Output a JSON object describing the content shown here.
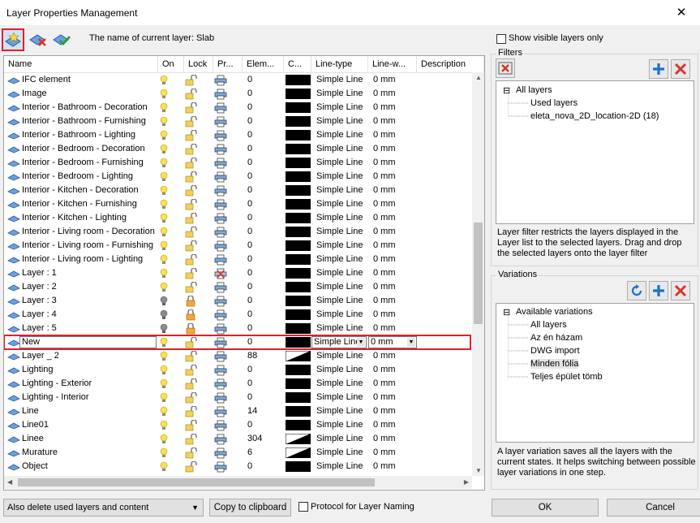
{
  "window": {
    "title": "Layer Properties Management",
    "close_glyph": "✕"
  },
  "toolbar": {
    "new_layer_icon": "new-layer-icon",
    "delete_layer_icon": "delete-layer-icon",
    "set_current_icon": "set-current-layer-icon",
    "current_layer_label": "The name of current layer: Slab"
  },
  "table": {
    "columns": [
      {
        "key": "name",
        "label": "Name"
      },
      {
        "key": "on",
        "label": "On"
      },
      {
        "key": "lock",
        "label": "Lock"
      },
      {
        "key": "print",
        "label": "Pr..."
      },
      {
        "key": "elem",
        "label": "Elem..."
      },
      {
        "key": "color",
        "label": "C..."
      },
      {
        "key": "linetype",
        "label": "Line-type"
      },
      {
        "key": "linewidth",
        "label": "Line-w..."
      },
      {
        "key": "description",
        "label": "Description"
      }
    ],
    "rows": [
      {
        "name": "IFC element",
        "on": true,
        "locked": false,
        "print": true,
        "elem": "0",
        "color": "solid",
        "linetype": "Simple Line",
        "lw": "0 mm"
      },
      {
        "name": "Image",
        "on": true,
        "locked": false,
        "print": true,
        "elem": "0",
        "color": "solid",
        "linetype": "Simple Line",
        "lw": "0 mm"
      },
      {
        "name": "Interior - Bathroom - Decoration",
        "on": true,
        "locked": false,
        "print": true,
        "elem": "0",
        "color": "solid",
        "linetype": "Simple Line",
        "lw": "0 mm"
      },
      {
        "name": "Interior - Bathroom - Furnishing",
        "on": true,
        "locked": false,
        "print": true,
        "elem": "0",
        "color": "solid",
        "linetype": "Simple Line",
        "lw": "0 mm"
      },
      {
        "name": "Interior - Bathroom - Lighting",
        "on": true,
        "locked": false,
        "print": true,
        "elem": "0",
        "color": "solid",
        "linetype": "Simple Line",
        "lw": "0 mm"
      },
      {
        "name": "Interior - Bedroom - Decoration",
        "on": true,
        "locked": false,
        "print": true,
        "elem": "0",
        "color": "solid",
        "linetype": "Simple Line",
        "lw": "0 mm"
      },
      {
        "name": "Interior - Bedroom - Furnishing",
        "on": true,
        "locked": false,
        "print": true,
        "elem": "0",
        "color": "solid",
        "linetype": "Simple Line",
        "lw": "0 mm"
      },
      {
        "name": "Interior - Bedroom - Lighting",
        "on": true,
        "locked": false,
        "print": true,
        "elem": "0",
        "color": "solid",
        "linetype": "Simple Line",
        "lw": "0 mm"
      },
      {
        "name": "Interior - Kitchen - Decoration",
        "on": true,
        "locked": false,
        "print": true,
        "elem": "0",
        "color": "solid",
        "linetype": "Simple Line",
        "lw": "0 mm"
      },
      {
        "name": "Interior - Kitchen - Furnishing",
        "on": true,
        "locked": false,
        "print": true,
        "elem": "0",
        "color": "solid",
        "linetype": "Simple Line",
        "lw": "0 mm"
      },
      {
        "name": "Interior - Kitchen - Lighting",
        "on": true,
        "locked": false,
        "print": true,
        "elem": "0",
        "color": "solid",
        "linetype": "Simple Line",
        "lw": "0 mm"
      },
      {
        "name": "Interior - Living room - Decoration",
        "on": true,
        "locked": false,
        "print": true,
        "elem": "0",
        "color": "solid",
        "linetype": "Simple Line",
        "lw": "0 mm"
      },
      {
        "name": "Interior - Living room - Furnishing",
        "on": true,
        "locked": false,
        "print": true,
        "elem": "0",
        "color": "solid",
        "linetype": "Simple Line",
        "lw": "0 mm"
      },
      {
        "name": "Interior - Living room - Lighting",
        "on": true,
        "locked": false,
        "print": true,
        "elem": "0",
        "color": "solid",
        "linetype": "Simple Line",
        "lw": "0 mm"
      },
      {
        "name": "Layer :  1",
        "on": true,
        "locked": false,
        "print": false,
        "elem": "0",
        "color": "solid",
        "linetype": "Simple Line",
        "lw": "0 mm"
      },
      {
        "name": "Layer :  2",
        "on": true,
        "locked": false,
        "print": true,
        "elem": "0",
        "color": "solid",
        "linetype": "Simple Line",
        "lw": "0 mm"
      },
      {
        "name": "Layer :  3",
        "on": false,
        "locked": true,
        "print": true,
        "elem": "0",
        "color": "solid",
        "linetype": "Simple Line",
        "lw": "0 mm"
      },
      {
        "name": "Layer :  4",
        "on": false,
        "locked": true,
        "print": true,
        "elem": "0",
        "color": "solid",
        "linetype": "Simple Line",
        "lw": "0 mm"
      },
      {
        "name": "Layer :  5",
        "on": false,
        "locked": true,
        "print": true,
        "elem": "0",
        "color": "solid",
        "linetype": "Simple Line",
        "lw": "0 mm"
      },
      {
        "name": "New",
        "on": true,
        "locked": false,
        "print": true,
        "elem": "0",
        "color": "solid",
        "linetype": "Simple Line",
        "lw": "0 mm",
        "editing": true
      },
      {
        "name": "Layer _ 2",
        "on": true,
        "locked": false,
        "print": true,
        "elem": "88",
        "color": "diag",
        "linetype": "Simple Line",
        "lw": "0 mm"
      },
      {
        "name": "Lighting",
        "on": true,
        "locked": false,
        "print": true,
        "elem": "0",
        "color": "solid",
        "linetype": "Simple Line",
        "lw": "0 mm"
      },
      {
        "name": "Lighting - Exterior",
        "on": true,
        "locked": false,
        "print": true,
        "elem": "0",
        "color": "solid",
        "linetype": "Simple Line",
        "lw": "0 mm"
      },
      {
        "name": "Lighting - Interior",
        "on": true,
        "locked": false,
        "print": true,
        "elem": "0",
        "color": "solid",
        "linetype": "Simple Line",
        "lw": "0 mm"
      },
      {
        "name": "Line",
        "on": true,
        "locked": false,
        "print": true,
        "elem": "14",
        "color": "solid",
        "linetype": "Simple Line",
        "lw": "0 mm"
      },
      {
        "name": "Line01",
        "on": true,
        "locked": false,
        "print": true,
        "elem": "0",
        "color": "solid",
        "linetype": "Simple Line",
        "lw": "0 mm"
      },
      {
        "name": "Linee",
        "on": true,
        "locked": false,
        "print": true,
        "elem": "304",
        "color": "diag",
        "linetype": "Simple Line",
        "lw": "0 mm"
      },
      {
        "name": "Murature",
        "on": true,
        "locked": false,
        "print": true,
        "elem": "6",
        "color": "diag",
        "linetype": "Simple Line",
        "lw": "0 mm"
      },
      {
        "name": "Object",
        "on": true,
        "locked": false,
        "print": true,
        "elem": "0",
        "color": "solid",
        "linetype": "Simple Line",
        "lw": "0 mm"
      }
    ]
  },
  "right": {
    "show_visible_label": "Show visible layers only",
    "filters_label": "Filters",
    "filters_tree": [
      {
        "label": "All layers",
        "level": 0,
        "expander": "⊟"
      },
      {
        "label": "Used layers",
        "level": 1
      },
      {
        "label": "eleta_nova_2D_location-2D (18)",
        "level": 1
      }
    ],
    "filters_desc": "Layer filter restricts the layers displayed in the Layer list to the selected layers. Drag and drop the selected layers onto the layer filter",
    "variations_label": "Variations",
    "variations_tree": [
      {
        "label": "Available variations",
        "level": 0,
        "expander": "⊟"
      },
      {
        "label": "All layers",
        "level": 1
      },
      {
        "label": "Az én házam",
        "level": 1
      },
      {
        "label": "DWG import",
        "level": 1
      },
      {
        "label": "Minden fólia",
        "level": 1
      },
      {
        "label": "Teljes épület tömb",
        "level": 1
      }
    ],
    "variations_desc": "A layer variation saves all the layers with the current states. It helps switching between possible layer variations in one step."
  },
  "bottom": {
    "delete_option": "Also delete used layers and content",
    "copy_button": "Copy to clipboard",
    "protocol_label": "Protocol for Layer Naming",
    "ok_button": "OK",
    "cancel_button": "Cancel"
  },
  "colors": {
    "accent_red": "#e0202a",
    "plus_blue": "#1f6fd0",
    "x_red": "#d9352b"
  }
}
